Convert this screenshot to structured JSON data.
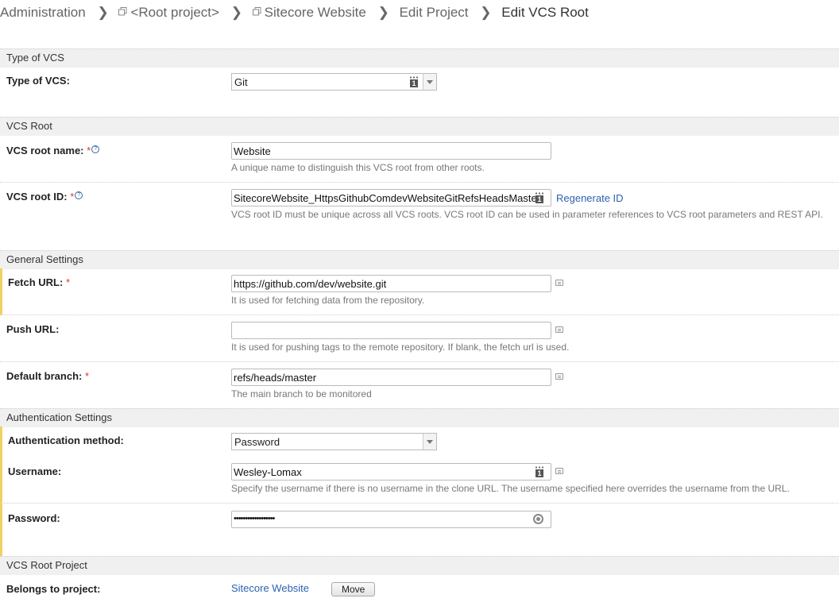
{
  "breadcrumb": {
    "items": [
      "Administration",
      "<Root project>",
      "Sitecore Website",
      "Edit Project",
      "Edit VCS Root"
    ]
  },
  "sections": {
    "type_of_vcs": "Type of VCS",
    "vcs_root": "VCS Root",
    "general": "General Settings",
    "auth": "Authentication Settings",
    "project": "VCS Root Project"
  },
  "fields": {
    "vcs_type": {
      "label": "Type of VCS:",
      "value": "Git"
    },
    "root_name": {
      "label": "VCS root name:",
      "value": "Website",
      "hint": "A unique name to distinguish this VCS root from other roots."
    },
    "root_id": {
      "label": "VCS root ID:",
      "value": "SitecoreWebsite_HttpsGithubComdevWebsiteGitRefsHeadsMaster",
      "action": "Regenerate ID",
      "hint": "VCS root ID must be unique across all VCS roots. VCS root ID can be used in parameter references to VCS root parameters and REST API."
    },
    "fetch_url": {
      "label": "Fetch URL:",
      "value": "https://github.com/dev/website.git",
      "hint": "It is used for fetching data from the repository."
    },
    "push_url": {
      "label": "Push URL:",
      "value": "",
      "hint": "It is used for pushing tags to the remote repository. If blank, the fetch url is used."
    },
    "default_branch": {
      "label": "Default branch:",
      "value": "refs/heads/master",
      "hint": "The main branch to be monitored"
    },
    "auth_method": {
      "label": "Authentication method:",
      "value": "Password"
    },
    "username": {
      "label": "Username:",
      "value": "Wesley-Lomax",
      "hint": "Specify the username if there is no username in the clone URL. The username specified here overrides the username from the URL."
    },
    "password": {
      "label": "Password:",
      "value": "••••••••••••••••••"
    },
    "belongs": {
      "label": "Belongs to project:",
      "value": "Sitecore Website",
      "button": "Move"
    }
  },
  "icons": [
    "breadcrumb-separator-icon",
    "project-icon",
    "help-icon",
    "parameter-icon",
    "notes-icon",
    "password-reveal-icon",
    "dropdown-arrow-icon"
  ],
  "colors": {
    "link": "#2d62b0",
    "required": "#d33333",
    "highlight": "#f0d262",
    "section_bg": "#f0f0f0"
  }
}
